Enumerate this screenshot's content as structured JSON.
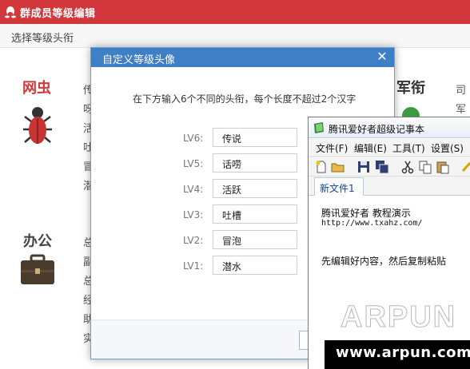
{
  "main_window": {
    "title": "群成员等级编辑",
    "subtitle": "选择等级头衔",
    "categories": {
      "wangchong": "网虫",
      "bangong": "办公",
      "junxian": "军衔"
    },
    "list_col1": [
      "传",
      "呀",
      "活",
      "吐",
      "冒",
      "潜"
    ],
    "list_col2": [
      "总",
      "副",
      "总",
      "经",
      "助",
      "实"
    ],
    "right_text": [
      "司",
      "军"
    ]
  },
  "dialog": {
    "title": "自定义等级头像",
    "instruction": "在下方输入6个不同的头衔，每个长度不超过2个汉字",
    "levels": [
      {
        "label": "LV6:",
        "value": "传说"
      },
      {
        "label": "LV5:",
        "value": "话唠"
      },
      {
        "label": "LV4:",
        "value": "活跃"
      },
      {
        "label": "LV3:",
        "value": "吐槽"
      },
      {
        "label": "LV2:",
        "value": "冒泡"
      },
      {
        "label": "LV1:",
        "value": "潜水"
      }
    ]
  },
  "notepad": {
    "title": "腾讯爱好者超级记事本",
    "menus": [
      "文件(F)",
      "编辑(E)",
      "工具(T)",
      "设置(S)"
    ],
    "tab": "新文件1",
    "lines": [
      "腾讯爱好者  教程演示",
      "http://www.txahz.com/",
      "先编辑好内容，然后复制粘贴"
    ]
  },
  "watermark": "ARPUN",
  "site_banner": "www.arpun.com",
  "colors": {
    "main_titlebar": "#d2383b",
    "dialog_titlebar": "#3e7fc6",
    "notepad_tab_text": "#0b45a8"
  },
  "icons": [
    "qq-penguin-icon",
    "bug-icon",
    "briefcase-icon",
    "notepad-app-icon",
    "close-icon"
  ]
}
